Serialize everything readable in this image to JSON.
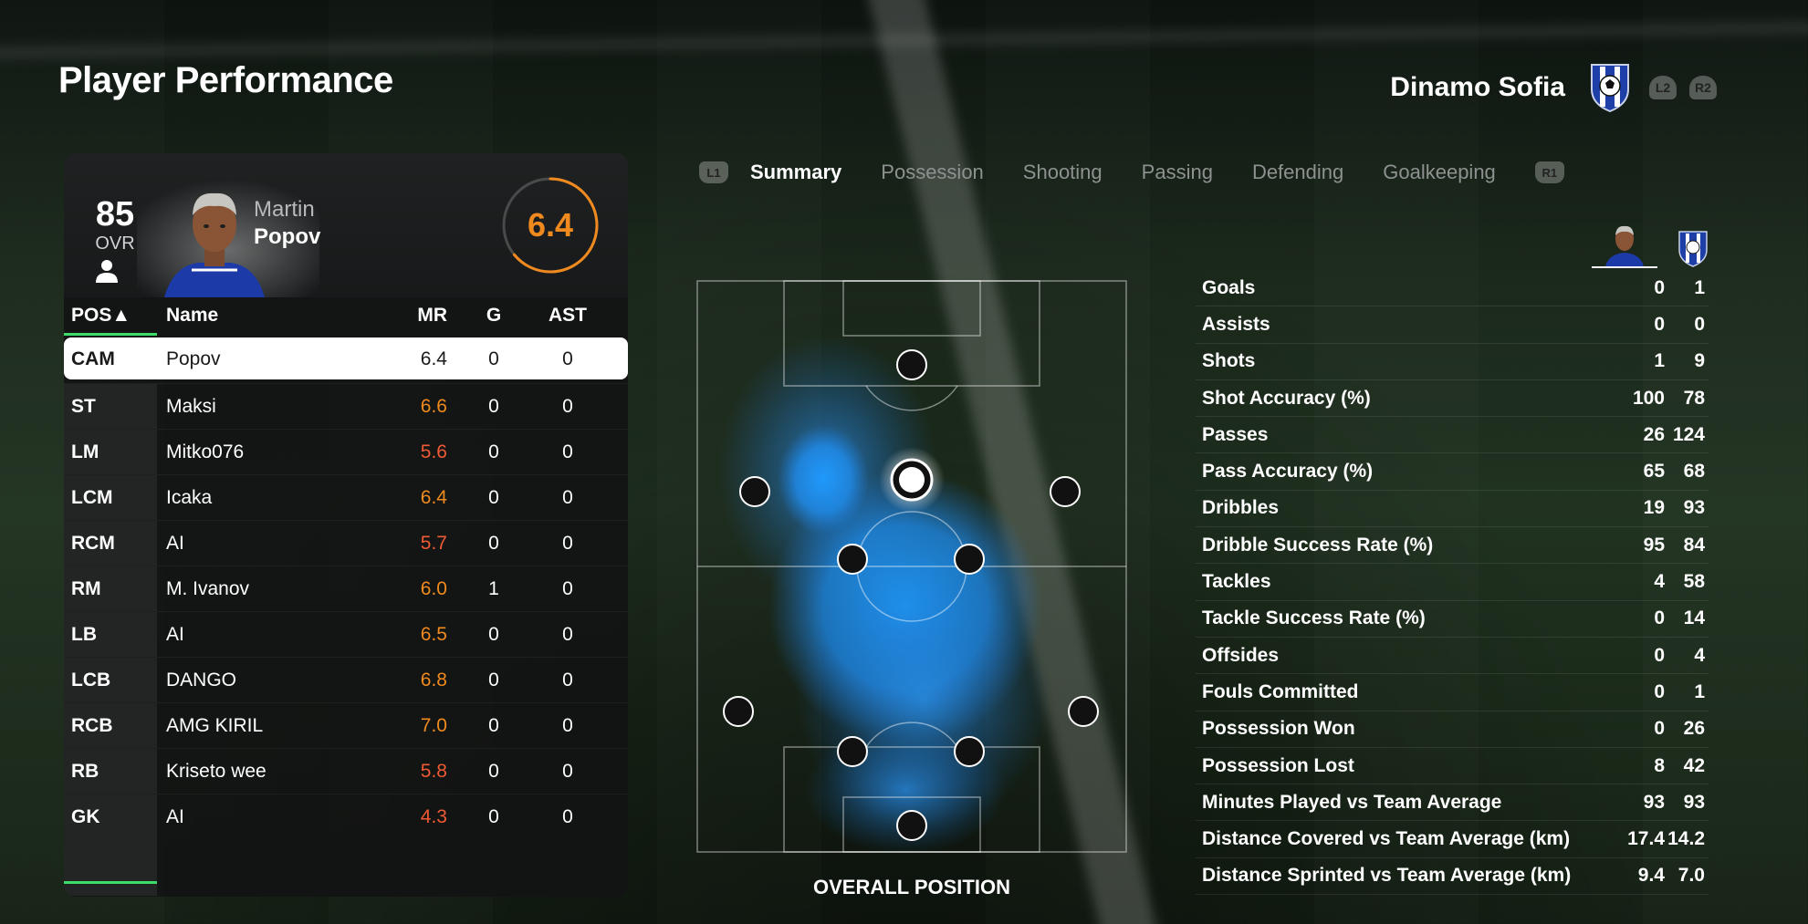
{
  "page_title": "Player Performance",
  "team": {
    "name": "Dinamo Sofia",
    "crest_icon": "team-crest-icon",
    "triggers": [
      "L2",
      "R2"
    ]
  },
  "player": {
    "ovr": "85",
    "ovr_label": "OVR",
    "first_name": "Martin",
    "last_name": "Popov",
    "match_rating": "6.4"
  },
  "table": {
    "headers": {
      "pos": "POS▲",
      "name": "Name",
      "mr": "MR",
      "g": "G",
      "ast": "AST"
    },
    "rows": [
      {
        "pos": "CAM",
        "name": "Popov",
        "mr": "6.4",
        "g": "0",
        "ast": "0",
        "mr_color": "selected"
      },
      {
        "pos": "ST",
        "name": "Maksi",
        "mr": "6.6",
        "g": "0",
        "ast": "0",
        "mr_color": "orange"
      },
      {
        "pos": "LM",
        "name": "Mitko076",
        "mr": "5.6",
        "g": "0",
        "ast": "0",
        "mr_color": "red"
      },
      {
        "pos": "LCM",
        "name": "Icaka",
        "mr": "6.4",
        "g": "0",
        "ast": "0",
        "mr_color": "orange"
      },
      {
        "pos": "RCM",
        "name": "AI",
        "mr": "5.7",
        "g": "0",
        "ast": "0",
        "mr_color": "red"
      },
      {
        "pos": "RM",
        "name": "M. Ivanov",
        "mr": "6.0",
        "g": "1",
        "ast": "0",
        "mr_color": "orange"
      },
      {
        "pos": "LB",
        "name": "AI",
        "mr": "6.5",
        "g": "0",
        "ast": "0",
        "mr_color": "orange"
      },
      {
        "pos": "LCB",
        "name": "DANGO",
        "mr": "6.8",
        "g": "0",
        "ast": "0",
        "mr_color": "orange"
      },
      {
        "pos": "RCB",
        "name": "AMG KIRIL",
        "mr": "7.0",
        "g": "0",
        "ast": "0",
        "mr_color": "orange"
      },
      {
        "pos": "RB",
        "name": "Kriseto wee",
        "mr": "5.8",
        "g": "0",
        "ast": "0",
        "mr_color": "red"
      },
      {
        "pos": "GK",
        "name": "AI",
        "mr": "4.3",
        "g": "0",
        "ast": "0",
        "mr_color": "red"
      }
    ]
  },
  "tabs": {
    "left_button": "L1",
    "right_button": "R1",
    "items": [
      "Summary",
      "Possession",
      "Shooting",
      "Passing",
      "Defending",
      "Goalkeeping"
    ],
    "active": "Summary"
  },
  "pitch": {
    "caption": "OVERALL POSITION"
  },
  "stats": [
    {
      "label": "Goals",
      "player": "0",
      "team": "1"
    },
    {
      "label": "Assists",
      "player": "0",
      "team": "0"
    },
    {
      "label": "Shots",
      "player": "1",
      "team": "9"
    },
    {
      "label": "Shot Accuracy (%)",
      "player": "100",
      "team": "78"
    },
    {
      "label": "Passes",
      "player": "26",
      "team": "124"
    },
    {
      "label": "Pass Accuracy (%)",
      "player": "65",
      "team": "68"
    },
    {
      "label": "Dribbles",
      "player": "19",
      "team": "93"
    },
    {
      "label": "Dribble Success Rate (%)",
      "player": "95",
      "team": "84"
    },
    {
      "label": "Tackles",
      "player": "4",
      "team": "58"
    },
    {
      "label": "Tackle Success Rate (%)",
      "player": "0",
      "team": "14"
    },
    {
      "label": "Offsides",
      "player": "0",
      "team": "4"
    },
    {
      "label": "Fouls Committed",
      "player": "0",
      "team": "1"
    },
    {
      "label": "Possession Won",
      "player": "0",
      "team": "26"
    },
    {
      "label": "Possession Lost",
      "player": "8",
      "team": "42"
    },
    {
      "label": "Minutes Played vs Team Average",
      "player": "93",
      "team": "93"
    },
    {
      "label": "Distance Covered vs Team Average (km)",
      "player": "17.4",
      "team": "14.2"
    },
    {
      "label": "Distance Sprinted vs Team Average (km)",
      "player": "9.4",
      "team": "7.0"
    }
  ],
  "colors": {
    "accent_green": "#3ddc6a",
    "rating_orange": "#f08a1e",
    "rating_red": "#ef5a35",
    "heat_blue": "#1f9bff"
  }
}
